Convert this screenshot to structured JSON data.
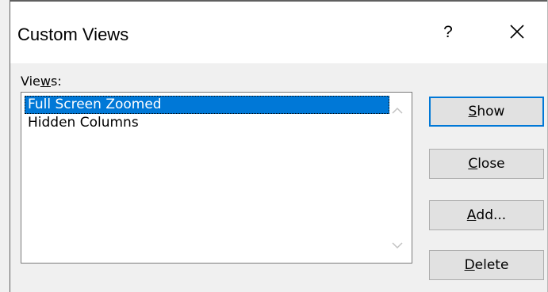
{
  "dialog": {
    "title": "Custom Views",
    "help_label": "?",
    "close_icon": "close-icon"
  },
  "views": {
    "label_pre": "Vie",
    "label_mn": "w",
    "label_post": "s:",
    "items": [
      {
        "label": "Full Screen Zoomed",
        "selected": true
      },
      {
        "label": "Hidden Columns",
        "selected": false
      }
    ]
  },
  "buttons": {
    "show": {
      "mn": "S",
      "rest": "how",
      "default": true
    },
    "close": {
      "mn": "C",
      "rest": "lose"
    },
    "add": {
      "mn": "A",
      "rest": "dd..."
    },
    "delete": {
      "mn": "D",
      "rest": "elete"
    }
  },
  "colors": {
    "selection": "#0078d7",
    "button_face": "#e1e1e1",
    "dialog_bg": "#f0f0f0"
  }
}
